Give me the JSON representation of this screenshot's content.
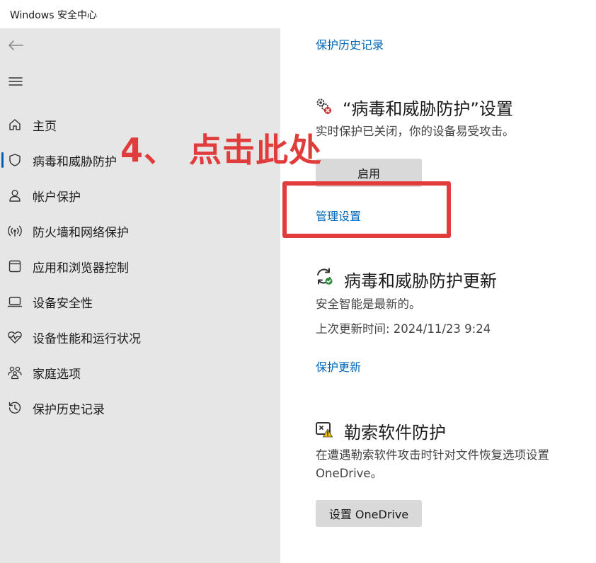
{
  "window": {
    "title": "Windows 安全中心"
  },
  "sidebar": {
    "back_icon": "back-arrow-icon",
    "menu_icon": "hamburger-menu-icon",
    "items": [
      {
        "label": "主页",
        "icon": "home-icon",
        "active": false
      },
      {
        "label": "病毒和威胁防护",
        "icon": "shield-icon",
        "active": true
      },
      {
        "label": "帐户保护",
        "icon": "person-icon",
        "active": false
      },
      {
        "label": "防火墙和网络保护",
        "icon": "wireless-icon",
        "active": false
      },
      {
        "label": "应用和浏览器控制",
        "icon": "app-window-icon",
        "active": false
      },
      {
        "label": "设备安全性",
        "icon": "laptop-icon",
        "active": false
      },
      {
        "label": "设备性能和运行状况",
        "icon": "heart-pulse-icon",
        "active": false
      },
      {
        "label": "家庭选项",
        "icon": "family-icon",
        "active": false
      },
      {
        "label": "保护历史记录",
        "icon": "history-icon",
        "active": false
      }
    ]
  },
  "main": {
    "history_link": "保护历史记录",
    "settings_section": {
      "icon": "gear-warning-icon",
      "title": "“病毒和威胁防护”设置",
      "description": "实时保护已关闭，你的设备易受攻击。",
      "enable_button": "启用",
      "manage_link": "管理设置"
    },
    "updates_section": {
      "icon": "update-check-icon",
      "title": "病毒和威胁防护更新",
      "status": "安全智能是最新的。",
      "last_update": "上次更新时间: 2024/11/23 9:24",
      "link": "保护更新"
    },
    "ransomware_section": {
      "icon": "ransomware-warning-icon",
      "title": "勒索软件防护",
      "description_line1": "在遭遇勒索软件攻击时针对文件恢复选项设置",
      "description_line2": "OneDrive。",
      "button": "设置 OneDrive"
    }
  },
  "annotation": {
    "text": "4、 点击此处",
    "color": "#e03c3c"
  },
  "colors": {
    "accent": "#005fb8",
    "link": "#0067b8",
    "sidebar_bg": "#e6e6e6",
    "annotation": "#e03c3c"
  }
}
